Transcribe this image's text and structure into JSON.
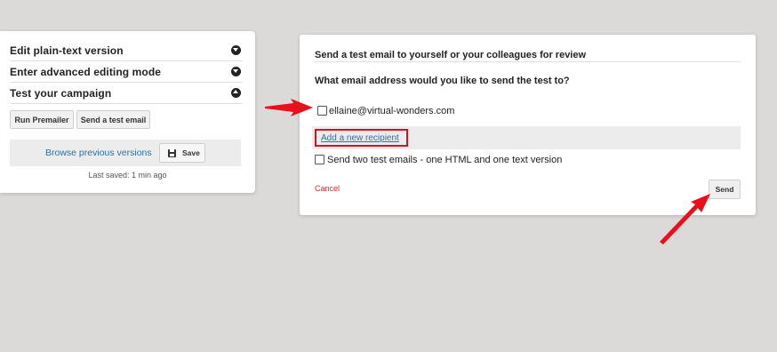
{
  "left_panel": {
    "accordion": [
      {
        "label": "Edit plain-text version",
        "state": "collapsed"
      },
      {
        "label": "Enter advanced editing mode",
        "state": "collapsed"
      },
      {
        "label": "Test your campaign",
        "state": "expanded"
      }
    ],
    "run_premailer_label": "Run Premailer",
    "send_test_email_label": "Send a test email",
    "browse_versions_label": "Browse previous versions",
    "save_label": "Save",
    "last_saved": "Last saved: 1 min ago"
  },
  "test_dialog": {
    "title": "Send a test email to yourself or your colleagues for review",
    "question": "What email address would you like to send the test to?",
    "recipient_email": "ellaine@virtual-wonders.com",
    "recipient_checked": false,
    "add_recipient_label": "Add a new recipient",
    "two_versions_label": "Send two test emails - one HTML and one text version",
    "two_versions_checked": false,
    "cancel_label": "Cancel",
    "send_label": "Send"
  },
  "colors": {
    "background": "#dcd9d9",
    "link": "#2a6fa8",
    "cancel": "#c9302c",
    "annotation_red": "#d8101a"
  }
}
